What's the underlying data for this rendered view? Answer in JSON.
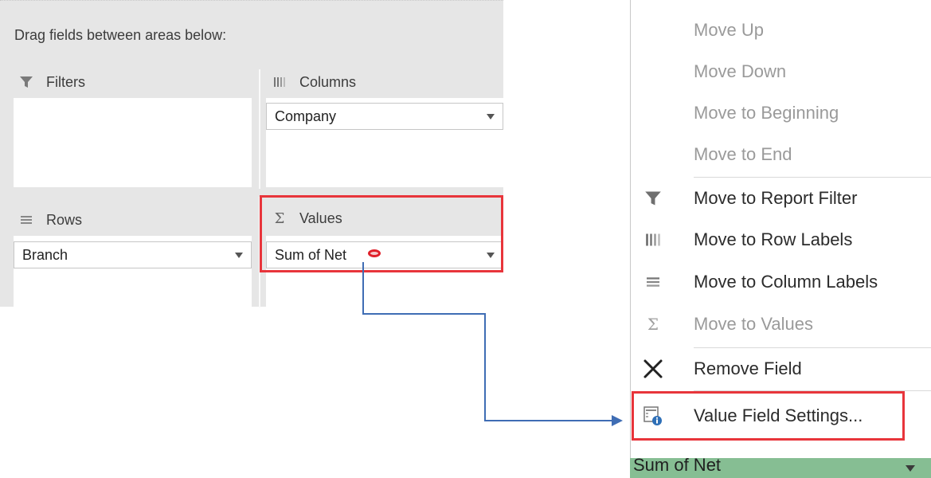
{
  "pane": {
    "instruction": "Drag fields between areas below:",
    "areas": {
      "filters": {
        "title": "Filters",
        "icon": "filter-icon"
      },
      "columns": {
        "title": "Columns",
        "icon": "columns-icon",
        "field": "Company"
      },
      "rows": {
        "title": "Rows",
        "icon": "rows-icon",
        "field": "Branch"
      },
      "values": {
        "title": "Values",
        "icon": "sigma-icon",
        "symbol": "Σ",
        "field": "Sum of Net"
      }
    }
  },
  "menu": {
    "items": [
      {
        "label": "Move Up",
        "accel": "U",
        "enabled": false,
        "icon": ""
      },
      {
        "label": "Move Down",
        "accel": "D",
        "enabled": false,
        "icon": ""
      },
      {
        "label": "Move to Beginning",
        "accel": "g",
        "enabled": false,
        "icon": ""
      },
      {
        "label": "Move to End",
        "accel": "E",
        "enabled": false,
        "icon": ""
      },
      {
        "label": "Move to Report Filter",
        "enabled": true,
        "icon": "filter-icon"
      },
      {
        "label": "Move to Row Labels",
        "enabled": true,
        "icon": "columns-icon"
      },
      {
        "label": "Move to Column Labels",
        "enabled": true,
        "icon": "rows-icon"
      },
      {
        "label": "Move to Values",
        "enabled": false,
        "icon": "sigma-icon",
        "symbol": "Σ"
      },
      {
        "label": "Remove Field",
        "enabled": true,
        "icon": "close-x-icon"
      },
      {
        "label": "Value Field Settings...",
        "accel": "n",
        "enabled": true,
        "icon": "field-settings-icon"
      }
    ],
    "selected_field": "Sum of Net"
  },
  "colors": {
    "highlight": "#e8353b",
    "connector": "#3f6db4",
    "selected_bar": "#86be93",
    "pane_bg": "#e6e6e6"
  }
}
